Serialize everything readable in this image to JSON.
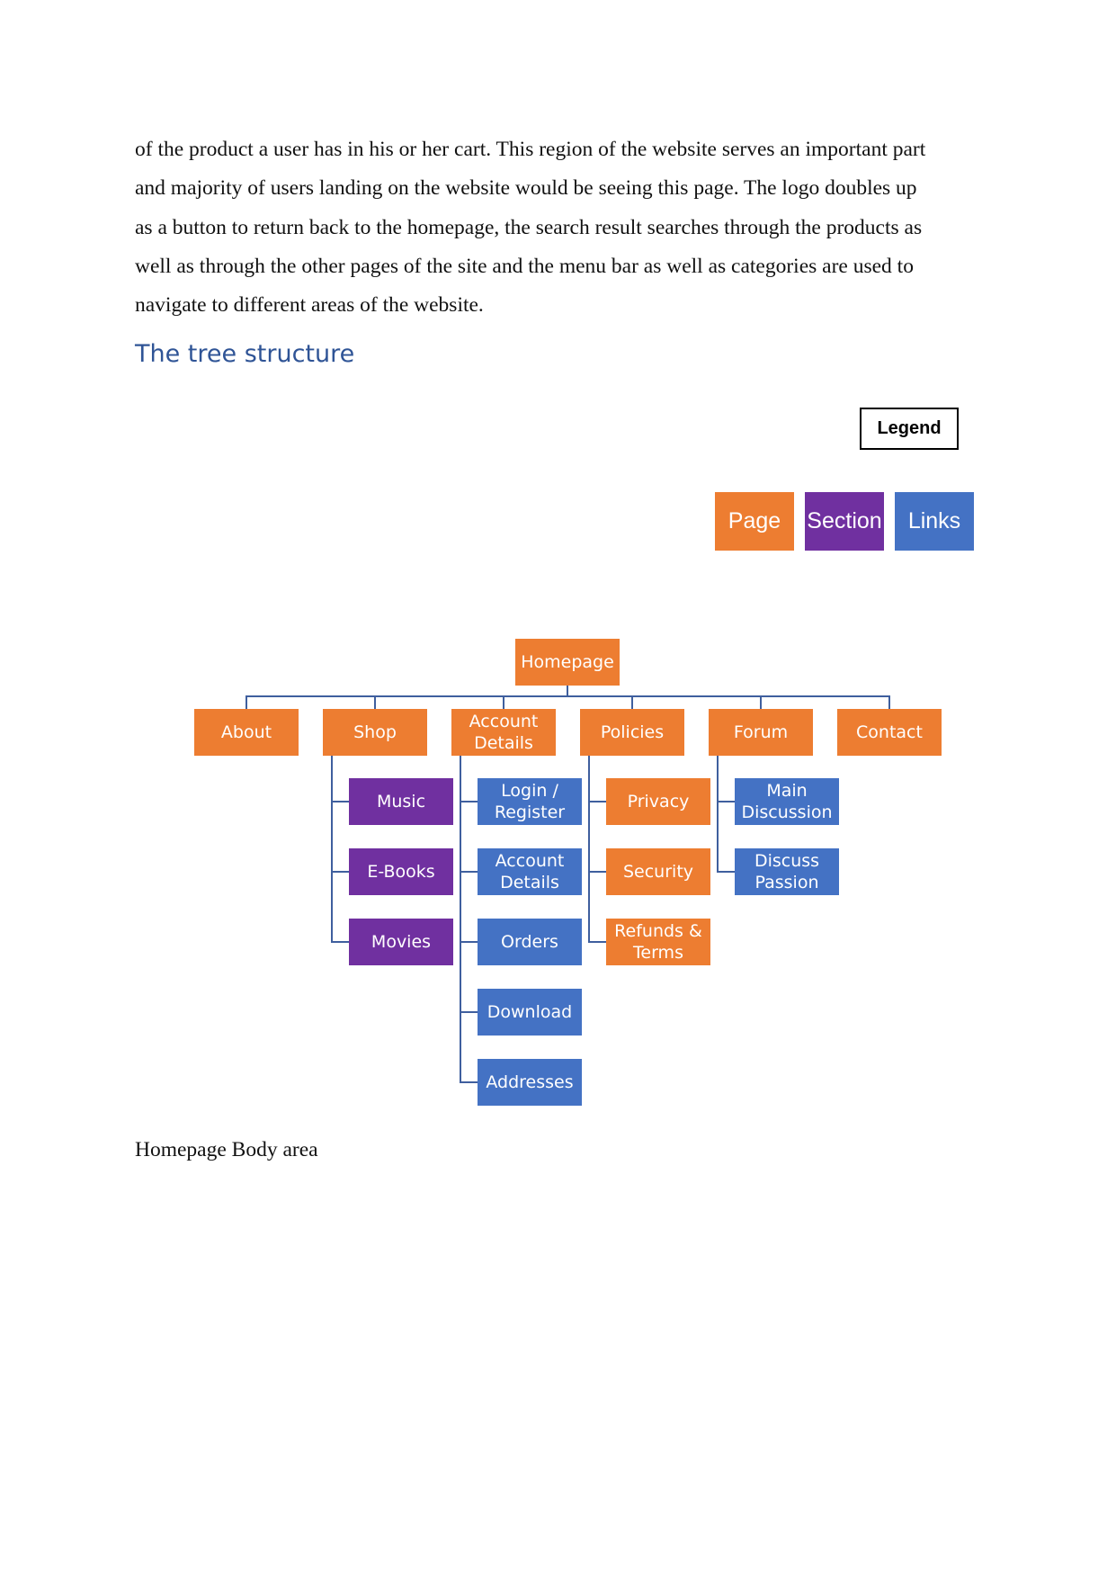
{
  "body_text": {
    "lines": [
      "of the product a user has in his or her cart. This region of the website serves an important part",
      "and majority of users landing on the website would be seeing this page. The logo doubles up",
      "as a button to return back to the homepage, the search result searches through the products as",
      "well as through the other pages of the site and the menu bar as well as categories are used to",
      "navigate to different areas of the website."
    ]
  },
  "heading": "The tree structure",
  "legend": {
    "title": "Legend",
    "keys": [
      {
        "label": "Page",
        "color": "#ED7D31"
      },
      {
        "label": "Section",
        "color": "#7030A0"
      },
      {
        "label": "Links",
        "color": "#4472C4"
      }
    ]
  },
  "tree": {
    "root": "Homepage",
    "children": [
      {
        "label": "About",
        "type": "page",
        "children": []
      },
      {
        "label": "Shop",
        "type": "page",
        "children": [
          {
            "label": "Music",
            "type": "section"
          },
          {
            "label": "E-Books",
            "type": "section"
          },
          {
            "label": "Movies",
            "type": "section"
          }
        ]
      },
      {
        "label": "Account Details",
        "type": "page",
        "children": [
          {
            "label": "Login / Register",
            "type": "link"
          },
          {
            "label": "Account Details",
            "type": "link"
          },
          {
            "label": "Orders",
            "type": "link"
          },
          {
            "label": "Download",
            "type": "link"
          },
          {
            "label": "Addresses",
            "type": "link"
          }
        ]
      },
      {
        "label": "Policies",
        "type": "page",
        "children": [
          {
            "label": "Privacy",
            "type": "page"
          },
          {
            "label": "Security",
            "type": "page"
          },
          {
            "label": "Refunds & Terms",
            "type": "page"
          }
        ]
      },
      {
        "label": "Forum",
        "type": "page",
        "children": [
          {
            "label": "Main Discussion",
            "type": "link"
          },
          {
            "label": "Discuss Passion",
            "type": "link"
          }
        ]
      },
      {
        "label": "Contact",
        "type": "page",
        "children": []
      }
    ]
  },
  "caption": "Homepage Body area"
}
